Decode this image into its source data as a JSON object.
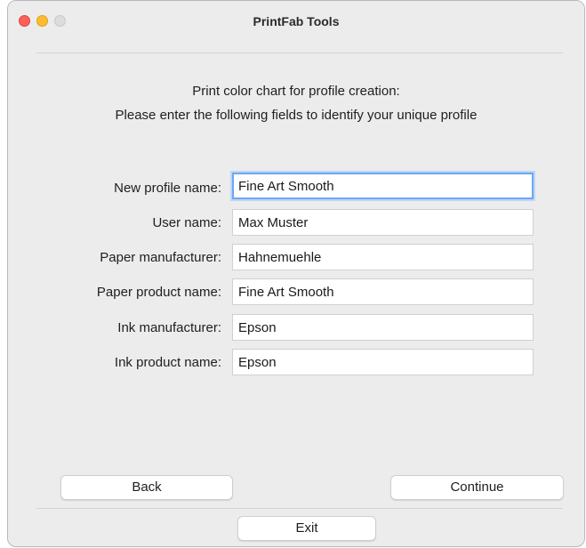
{
  "window": {
    "title": "PrintFab Tools"
  },
  "intro": {
    "line1": "Print color chart for profile creation:",
    "line2": "Please enter the following fields to identify your unique profile"
  },
  "fields": [
    {
      "label": "New profile name:",
      "value": "Fine Art Smooth"
    },
    {
      "label": "User name:",
      "value": "Max Muster"
    },
    {
      "label": "Paper manufacturer:",
      "value": "Hahnemuehle"
    },
    {
      "label": "Paper product name:",
      "value": "Fine Art Smooth"
    },
    {
      "label": "Ink manufacturer:",
      "value": "Epson"
    },
    {
      "label": "Ink product name:",
      "value": "Epson"
    }
  ],
  "buttons": {
    "back": "Back",
    "continue": "Continue",
    "exit": "Exit"
  }
}
